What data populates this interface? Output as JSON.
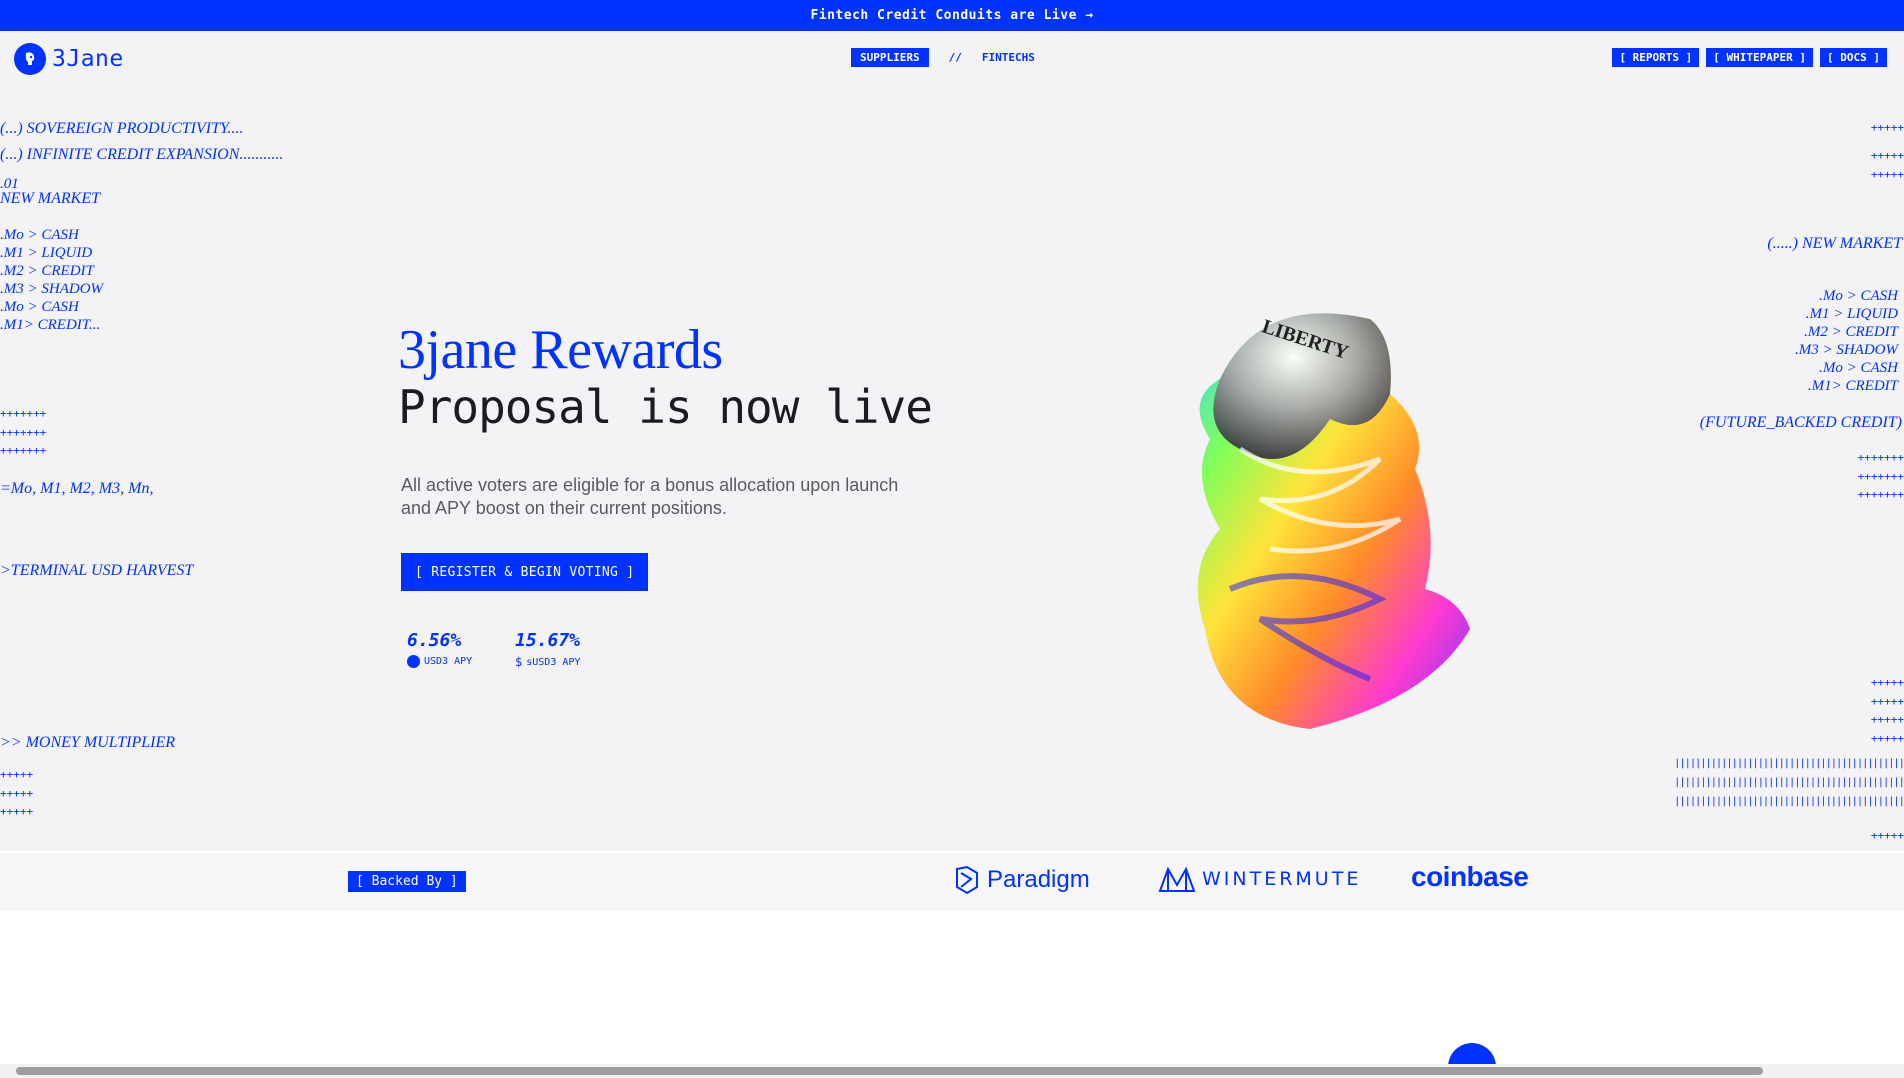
{
  "banner": {
    "text": "Fintech Credit Conduits are Live →"
  },
  "brand": {
    "name": "3Jane"
  },
  "nav": {
    "suppliers": "SUPPLIERS",
    "sep": "//",
    "fintechs": "FINTECHS"
  },
  "links": {
    "reports": "[ REPORTS ]",
    "whitepaper": "[ WHITEPAPER ]",
    "docs": "[ DOCS ]"
  },
  "left_deco": {
    "l1": "(...) SOVEREIGN PRODUCTIVITY....",
    "l2": "(...) INFINITE CREDIT EXPANSION...........",
    "l3": ".01",
    "l4": "NEW MARKET",
    "list": ".Mo > CASH\n.M1 > LIQUID\n.M2 > CREDIT\n.M3 > SHADOW\n.Mo > CASH\n.M1> CREDIT...",
    "plus1": "+++++++\n+++++++\n+++++++",
    "series": "=Mo, M1, M2, M3, Mn,",
    "harvest": ">TERMINAL USD HARVEST",
    "multiplier": ">> MONEY MULTIPLIER",
    "plus2": "+++++\n+++++\n+++++"
  },
  "right_deco": {
    "plus1": "+++++",
    "plus2": "+++++\n+++++",
    "market": "(.....) NEW MARKET",
    "list": ".Mo > CASH\n.M1 > LIQUID\n.M2 > CREDIT\n.M3 > SHADOW\n.Mo > CASH\n.M1> CREDIT",
    "future": "(FUTURE_BACKED CREDIT)",
    "plus3": "+++++++\n+++++++\n+++++++",
    "plus4": "+++++\n+++++\n+++++\n+++++",
    "bars": "||||||||||||||||||||||||||||||||||||||||||||\n||||||||||||||||||||||||||||||||||||||||||||\n||||||||||||||||||||||||||||||||||||||||||||",
    "plus5": "+++++\n....."
  },
  "hero": {
    "title": "3jane Rewards",
    "subtitle": "Proposal is now live",
    "description": "All active voters are eligible for a bonus allocation upon launch and APY boost on their current positions.",
    "cta": "[ REGISTER & BEGIN VOTING ]",
    "coin_text": "LIBERTY"
  },
  "stats": [
    {
      "value": "6.56%",
      "label": "USD3 APY"
    },
    {
      "value": "15.67%",
      "label": "sUSD3 APY"
    }
  ],
  "backed": {
    "label": "[ Backed By ]",
    "partners": [
      "Paradigm",
      "WINTERMUTE",
      "coinbase"
    ]
  },
  "colors": {
    "accent": "#0033ff",
    "background": "#f3f3f5",
    "text": "#1b1b24"
  }
}
